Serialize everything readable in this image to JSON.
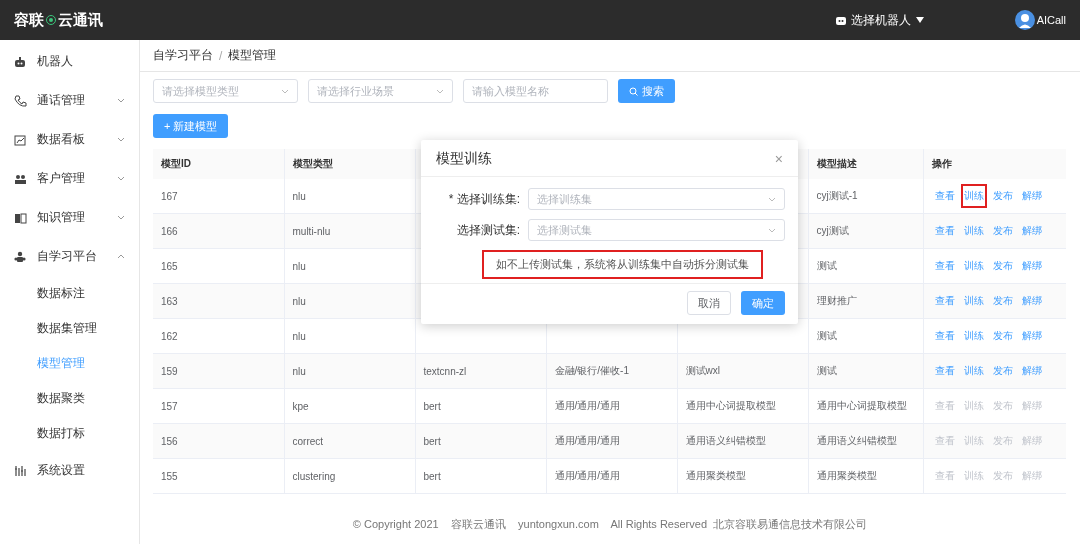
{
  "header": {
    "logo": "容联",
    "logo_suffix": "云通讯",
    "robot_select": "选择机器人",
    "user": "AICall"
  },
  "sidebar": {
    "items": [
      {
        "label": "机器人"
      },
      {
        "label": "通话管理",
        "expandable": true,
        "expanded": false
      },
      {
        "label": "数据看板",
        "expandable": true,
        "expanded": false
      },
      {
        "label": "客户管理",
        "expandable": true,
        "expanded": false
      },
      {
        "label": "知识管理",
        "expandable": true,
        "expanded": false
      },
      {
        "label": "自学习平台",
        "expandable": true,
        "expanded": true,
        "children": [
          {
            "label": "数据标注",
            "selected": false
          },
          {
            "label": "数据集管理",
            "selected": false
          },
          {
            "label": "模型管理",
            "selected": true
          },
          {
            "label": "数据聚类",
            "selected": false
          },
          {
            "label": "数据打标",
            "selected": false
          }
        ]
      },
      {
        "label": "系统设置"
      }
    ]
  },
  "breadcrumb": {
    "items": [
      "自学习平台",
      "模型管理"
    ],
    "separator": "/"
  },
  "filters": {
    "model_type": {
      "placeholder": "请选择模型类型"
    },
    "industry": {
      "placeholder": "请选择行业场景"
    },
    "name": {
      "placeholder": "请输入模型名称"
    },
    "search_button": "搜索"
  },
  "new_button": "+ 新建模型",
  "table": {
    "columns": [
      "模型ID",
      "模型类型",
      "",
      "",
      "",
      "模型描述",
      "操作"
    ],
    "rows": [
      {
        "id": "167",
        "type": "nlu",
        "description": "cyj测试-1",
        "enabled": true,
        "actions": [
          {
            "label": "查看",
            "highlighted": false
          },
          {
            "label": "训练",
            "highlighted": true
          },
          {
            "label": "发布",
            "highlighted": false
          },
          {
            "label": "解绑",
            "highlighted": false
          }
        ]
      },
      {
        "id": "166",
        "type": "multi-nlu",
        "description": "cyj测试",
        "enabled": true,
        "actions": [
          {
            "label": "查看",
            "highlighted": false
          },
          {
            "label": "训练",
            "highlighted": false
          },
          {
            "label": "发布",
            "highlighted": false
          },
          {
            "label": "解绑",
            "highlighted": false
          }
        ]
      },
      {
        "id": "165",
        "type": "nlu",
        "description": "测试",
        "enabled": true,
        "actions": [
          {
            "label": "查看",
            "highlighted": false
          },
          {
            "label": "训练",
            "highlighted": false
          },
          {
            "label": "发布",
            "highlighted": false
          },
          {
            "label": "解绑",
            "highlighted": false
          }
        ]
      },
      {
        "id": "163",
        "type": "nlu",
        "description": "理财推广",
        "enabled": true,
        "actions": [
          {
            "label": "查看",
            "highlighted": false
          },
          {
            "label": "训练",
            "highlighted": false
          },
          {
            "label": "发布",
            "highlighted": false
          },
          {
            "label": "解绑",
            "highlighted": false
          }
        ]
      },
      {
        "id": "162",
        "type": "nlu",
        "description": "测试",
        "enabled": true,
        "actions": [
          {
            "label": "查看",
            "highlighted": false
          },
          {
            "label": "训练",
            "highlighted": false
          },
          {
            "label": "发布",
            "highlighted": false
          },
          {
            "label": "解绑",
            "highlighted": false
          }
        ]
      },
      {
        "id": "159",
        "type": "nlu",
        "column_3": "textcnn-zl",
        "column_4": "金融/银行/催收-1",
        "column_5": "测试wxl",
        "description": "测试",
        "enabled": true,
        "actions": [
          {
            "label": "查看",
            "highlighted": false
          },
          {
            "label": "训练",
            "highlighted": false
          },
          {
            "label": "发布",
            "highlighted": false
          },
          {
            "label": "解绑",
            "highlighted": false
          }
        ]
      },
      {
        "id": "157",
        "type": "kpe",
        "column_3": "bert",
        "column_4": "通用/通用/通用",
        "column_5": "通用中心词提取模型",
        "description": "通用中心词提取模型",
        "enabled": false,
        "actions": [
          {
            "label": "查看",
            "highlighted": false
          },
          {
            "label": "训练",
            "highlighted": false
          },
          {
            "label": "发布",
            "highlighted": false
          },
          {
            "label": "解绑",
            "highlighted": false
          }
        ]
      },
      {
        "id": "156",
        "type": "correct",
        "column_3": "bert",
        "column_4": "通用/通用/通用",
        "column_5": "通用语义纠错模型",
        "description": "通用语义纠错模型",
        "enabled": false,
        "actions": [
          {
            "label": "查看",
            "highlighted": false
          },
          {
            "label": "训练",
            "highlighted": false
          },
          {
            "label": "发布",
            "highlighted": false
          },
          {
            "label": "解绑",
            "highlighted": false
          }
        ]
      },
      {
        "id": "155",
        "type": "clustering",
        "column_3": "bert",
        "column_4": "通用/通用/通用",
        "column_5": "通用聚类模型",
        "description": "通用聚类模型",
        "enabled": false,
        "actions": [
          {
            "label": "查看",
            "highlighted": false
          },
          {
            "label": "训练",
            "highlighted": false
          },
          {
            "label": "发布",
            "highlighted": false
          },
          {
            "label": "解绑",
            "highlighted": false
          }
        ]
      }
    ]
  },
  "dialog": {
    "title": "模型训练",
    "close": "×",
    "fields": [
      {
        "label": "* 选择训练集:",
        "placeholder": "选择训练集"
      },
      {
        "label": "选择测试集:",
        "placeholder": "选择测试集"
      }
    ],
    "note": "如不上传测试集，系统将从训练集中自动拆分测试集",
    "note_highlighted": true,
    "buttons": [
      {
        "label": "取消",
        "primary": false
      },
      {
        "label": "确定",
        "primary": true
      }
    ]
  },
  "footer": "© Copyright 2021    容联云通讯    yuntongxun.com    All Rights Reserved  北京容联易通信息技术有限公司"
}
